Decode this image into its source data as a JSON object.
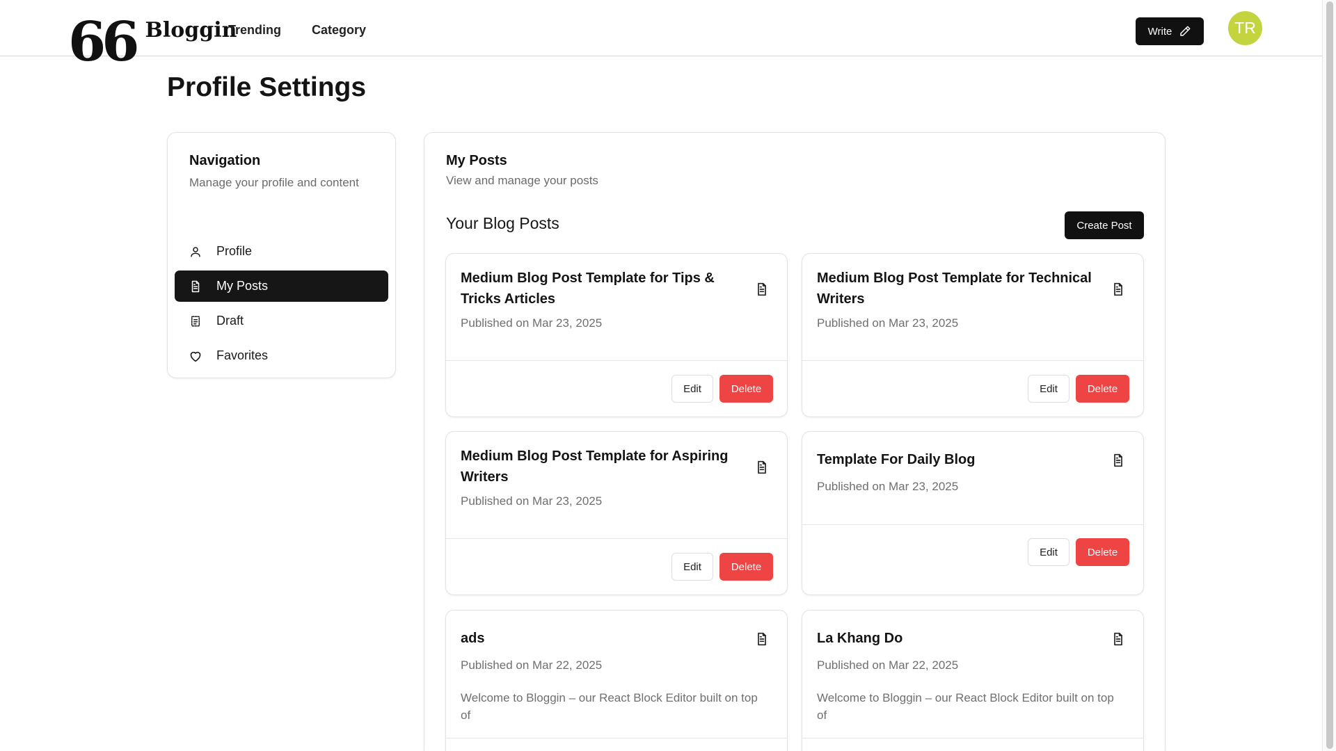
{
  "app": {
    "logo_mark": "66",
    "logo_text": "Bloggin"
  },
  "header": {
    "nav": [
      "Trending",
      "Category"
    ],
    "write_label": "Write",
    "avatar_initials": "TR",
    "avatar_color": "#c3d43f"
  },
  "page": {
    "title": "Profile Settings"
  },
  "sidebar": {
    "title": "Navigation",
    "subtitle": "Manage your profile and content",
    "items": [
      {
        "label": "Profile",
        "icon": "user-icon",
        "active": false
      },
      {
        "label": "My Posts",
        "icon": "document-icon",
        "active": true
      },
      {
        "label": "Draft",
        "icon": "draft-icon",
        "active": false
      },
      {
        "label": "Favorites",
        "icon": "heart-icon",
        "active": false
      }
    ]
  },
  "main": {
    "title": "My Posts",
    "subtitle": "View and manage your posts",
    "section_title": "Your Blog Posts",
    "create_label": "Create Post",
    "posts": [
      {
        "title": "Medium Blog Post Template for Tips & Tricks Articles",
        "date": "Published on Mar 23, 2025",
        "excerpt": ""
      },
      {
        "title": "Medium Blog Post Template for Technical Writers",
        "date": "Published on Mar 23, 2025",
        "excerpt": ""
      },
      {
        "title": "Medium Blog Post Template for Aspiring Writers",
        "date": "Published on Mar 23, 2025",
        "excerpt": ""
      },
      {
        "title": "Template For Daily Blog",
        "date": "Published on Mar 23, 2025",
        "excerpt": ""
      },
      {
        "title": "ads",
        "date": "Published on Mar 22, 2025",
        "excerpt": "Welcome to Bloggin – our React Block Editor built on top of"
      },
      {
        "title": "La Khang Do",
        "date": "Published on Mar 22, 2025",
        "excerpt": "Welcome to Bloggin – our React Block Editor built on top of"
      }
    ],
    "edit_label": "Edit",
    "delete_label": "Delete"
  },
  "colors": {
    "primary": "#111111",
    "danger": "#ef4444",
    "muted_text": "#6b6b6b",
    "border": "#e2e2e2"
  }
}
